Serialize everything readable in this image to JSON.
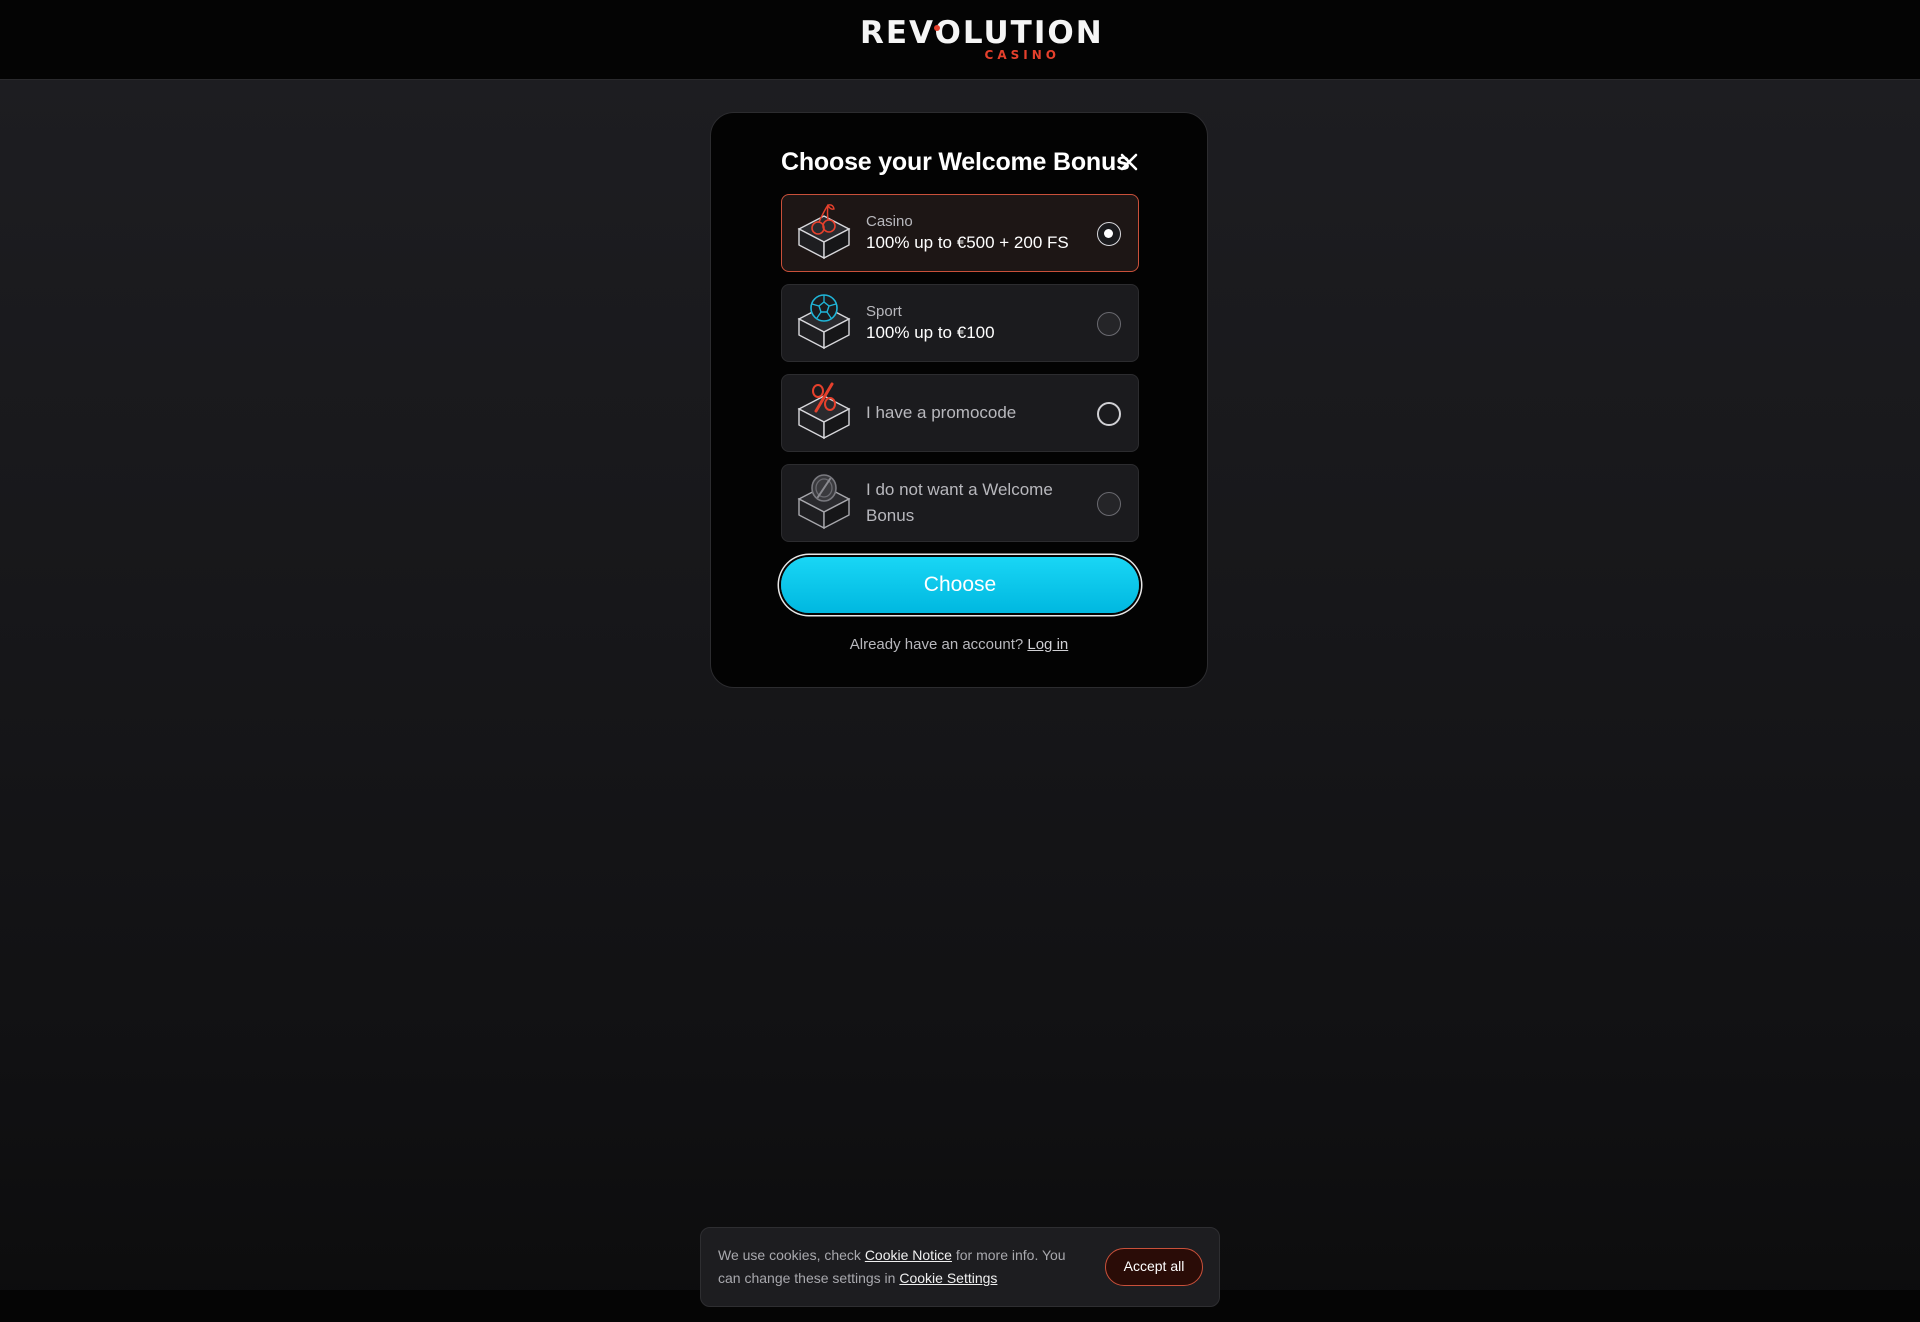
{
  "header": {
    "logo_text": "REVOLUTION",
    "logo_sub": "CASINO"
  },
  "modal": {
    "title": "Choose your Welcome Bonus",
    "options": [
      {
        "category": "Casino",
        "offer": "100% up to €500 + 200 FS",
        "icon": "cherries-box-icon",
        "selected": true
      },
      {
        "category": "Sport",
        "offer": "100% up to €100",
        "icon": "soccer-ball-box-icon",
        "selected": false
      },
      {
        "label": "I have a promocode",
        "icon": "percent-box-icon",
        "selected": false
      },
      {
        "label": "I do not want a Welcome Bonus",
        "icon": "no-coin-box-icon",
        "selected": false
      }
    ],
    "choose_label": "Choose",
    "account_prompt": "Already have an account?",
    "login_label": "Log in"
  },
  "cookie": {
    "text_1": "We use cookies, check",
    "link_1": "Cookie Notice",
    "text_2": "for more info. You can change these settings in",
    "link_2": "Cookie Settings",
    "accept_label": "Accept all"
  },
  "colors": {
    "accent_red": "#e5402c",
    "button_cyan": "#00c4ea",
    "selected_border": "#c9503a"
  }
}
